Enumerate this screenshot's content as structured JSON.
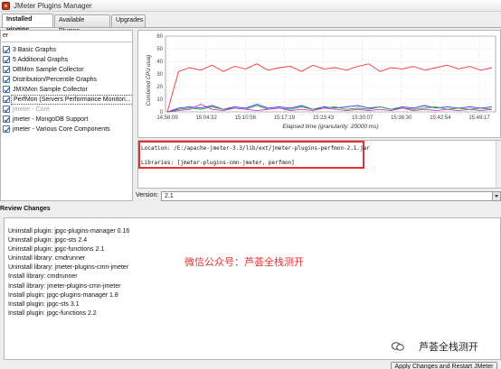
{
  "window": {
    "title": "JMeter Plugins Manager"
  },
  "tabs": [
    {
      "label": "Installed Plugins",
      "active": true
    },
    {
      "label": "Available Plugins",
      "active": false
    },
    {
      "label": "Upgrades",
      "active": false
    }
  ],
  "search": {
    "value": "er"
  },
  "plugins": [
    {
      "label": "3 Basic Graphs",
      "checked": true,
      "disabled": false
    },
    {
      "label": "5 Additional Graphs",
      "checked": true,
      "disabled": false
    },
    {
      "label": "DBMon Sample Collector",
      "checked": true,
      "disabled": false
    },
    {
      "label": "Distribution/Percentile Graphs",
      "checked": true,
      "disabled": false
    },
    {
      "label": "JMXMon Sample Collector",
      "checked": true,
      "disabled": false
    },
    {
      "label": "PerfMon (Servers Performance Monitori...",
      "checked": true,
      "disabled": false,
      "selected": true
    },
    {
      "label": "jmeter - Core",
      "checked": true,
      "disabled": true
    },
    {
      "label": "jmeter - MongoDB Support",
      "checked": true,
      "disabled": false
    },
    {
      "label": "jmeter - Various Core Components",
      "checked": true,
      "disabled": false
    }
  ],
  "chart_data": {
    "type": "line",
    "ylabel": "Combined CPU usag",
    "xlabel": "Elapsed time (granularity: 20000 ms)",
    "ylim": [
      0,
      60
    ],
    "yticks": [
      0,
      10,
      20,
      30,
      40,
      50,
      60
    ],
    "xticks": [
      "14:58:09",
      "15:04:32",
      "15:10:56",
      "15:17:19",
      "15:23:43",
      "15:30:07",
      "15:36:30",
      "15:42:54",
      "15:49:17"
    ],
    "grid": true,
    "series": [
      {
        "color": "#ff3333",
        "values": [
          0,
          32,
          35,
          33,
          37,
          32,
          36,
          34,
          38,
          33,
          35,
          36,
          32,
          37,
          34,
          35,
          33,
          36,
          38,
          32,
          35,
          34,
          36,
          33,
          35,
          37,
          34,
          36,
          33,
          35
        ]
      },
      {
        "color": "#3333ff",
        "values": [
          0,
          3,
          4,
          3,
          5,
          2,
          4,
          3,
          6,
          3,
          4,
          3,
          5,
          2,
          4,
          3,
          4,
          5,
          3,
          4,
          2,
          4,
          3,
          5,
          3,
          4,
          3,
          4,
          3,
          4
        ]
      },
      {
        "color": "#22aa22",
        "values": [
          0,
          2,
          3,
          2,
          4,
          2,
          3,
          2,
          5,
          2,
          3,
          2,
          4,
          2,
          3,
          4,
          2,
          3,
          2,
          4,
          2,
          3,
          2,
          3,
          4,
          2,
          3,
          2,
          3,
          2
        ]
      },
      {
        "color": "#cc33cc",
        "values": [
          0,
          1,
          2,
          6,
          2,
          1,
          3,
          2,
          1,
          2,
          3,
          1,
          2,
          1,
          3,
          2,
          1,
          2,
          1,
          2,
          1,
          3,
          1,
          2,
          1,
          2,
          1,
          2,
          1,
          2
        ]
      }
    ]
  },
  "info": {
    "location": "Location: /E:/apache-jmeter-3.3/lib/ext/jmeter-plugins-perfmon-2.1.jar",
    "libraries": "Libraries: [jmeter-plugins-cmn-jmeter, perfmon]"
  },
  "version": {
    "label": "Version:",
    "value": "2.1"
  },
  "review": {
    "header": "Review Changes",
    "lines": [
      "Uninstall plugin: jpgc-plugins-manager 0.16",
      "Uninstall plugin: jpgc-sts 2.4",
      "Uninstall plugin: jpgc-functions 2.1",
      "Uninstall library: cmdrunner",
      "Uninstall library: jmeter-plugins-cmn-jmeter",
      "Install library: cmdrunner",
      "Install library: jmeter-plugins-cmn-jmeter",
      "Install plugin: jpgc-plugins-manager 1.8",
      "Install plugin: jpgc-sts 3.1",
      "Install plugin: jpgc-functions 2.2"
    ],
    "watermark": "微信公众号：芦荟全栈测开",
    "brand": "芦荟全栈测开"
  },
  "apply_button": {
    "label": "Apply Changes and Restart JMeter"
  }
}
